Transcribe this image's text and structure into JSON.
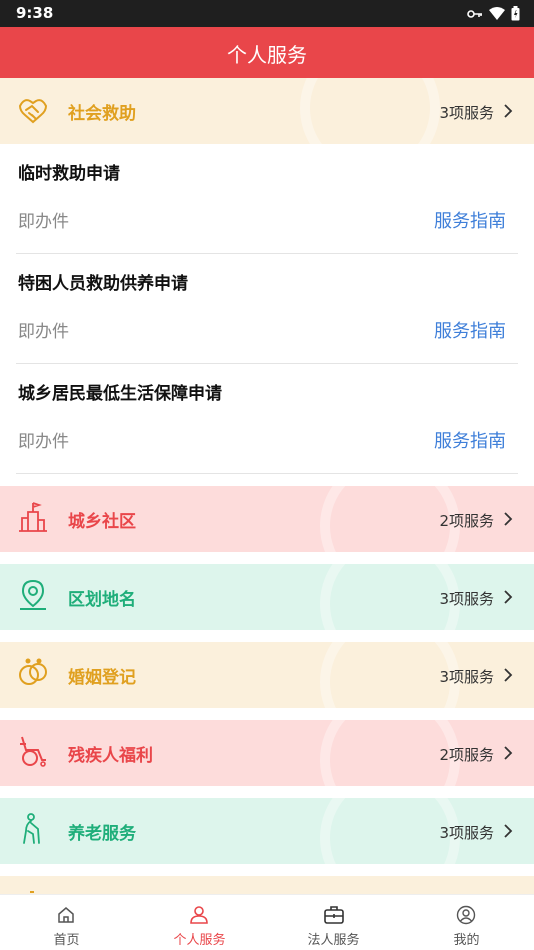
{
  "status_bar": {
    "time": "9:38"
  },
  "header": {
    "title": "个人服务"
  },
  "categories": [
    {
      "name": "社会救助",
      "count": "3项服务",
      "theme": "yellow",
      "color": "#e0a020",
      "icon": "handshake-icon"
    },
    {
      "name": "城乡社区",
      "count": "2项服务",
      "theme": "pink",
      "color": "#e9464a",
      "icon": "community-building-icon"
    },
    {
      "name": "区划地名",
      "count": "3项服务",
      "theme": "green",
      "color": "#1fae7a",
      "icon": "location-pin-icon"
    },
    {
      "name": "婚姻登记",
      "count": "3项服务",
      "theme": "yellow",
      "color": "#e0a020",
      "icon": "marriage-rings-icon"
    },
    {
      "name": "残疾人福利",
      "count": "2项服务",
      "theme": "pink",
      "color": "#e9464a",
      "icon": "wheelchair-icon"
    },
    {
      "name": "养老服务",
      "count": "3项服务",
      "theme": "green",
      "color": "#1fae7a",
      "icon": "elderly-walking-icon"
    }
  ],
  "services": [
    {
      "name": "临时救助申请",
      "type": "即办件",
      "guide": "服务指南"
    },
    {
      "name": "特困人员救助供养申请",
      "type": "即办件",
      "guide": "服务指南"
    },
    {
      "name": "城乡居民最低生活保障申请",
      "type": "即办件",
      "guide": "服务指南"
    }
  ],
  "bottom_nav": [
    {
      "label": "首页",
      "icon": "home-icon",
      "active": false
    },
    {
      "label": "个人服务",
      "icon": "person-icon",
      "active": true
    },
    {
      "label": "法人服务",
      "icon": "briefcase-icon",
      "active": false
    },
    {
      "label": "我的",
      "icon": "profile-icon",
      "active": false
    }
  ],
  "colors": {
    "accent": "#e9464a",
    "link": "#3f7fd9",
    "yellow": "#e0a020",
    "green": "#1fae7a"
  }
}
